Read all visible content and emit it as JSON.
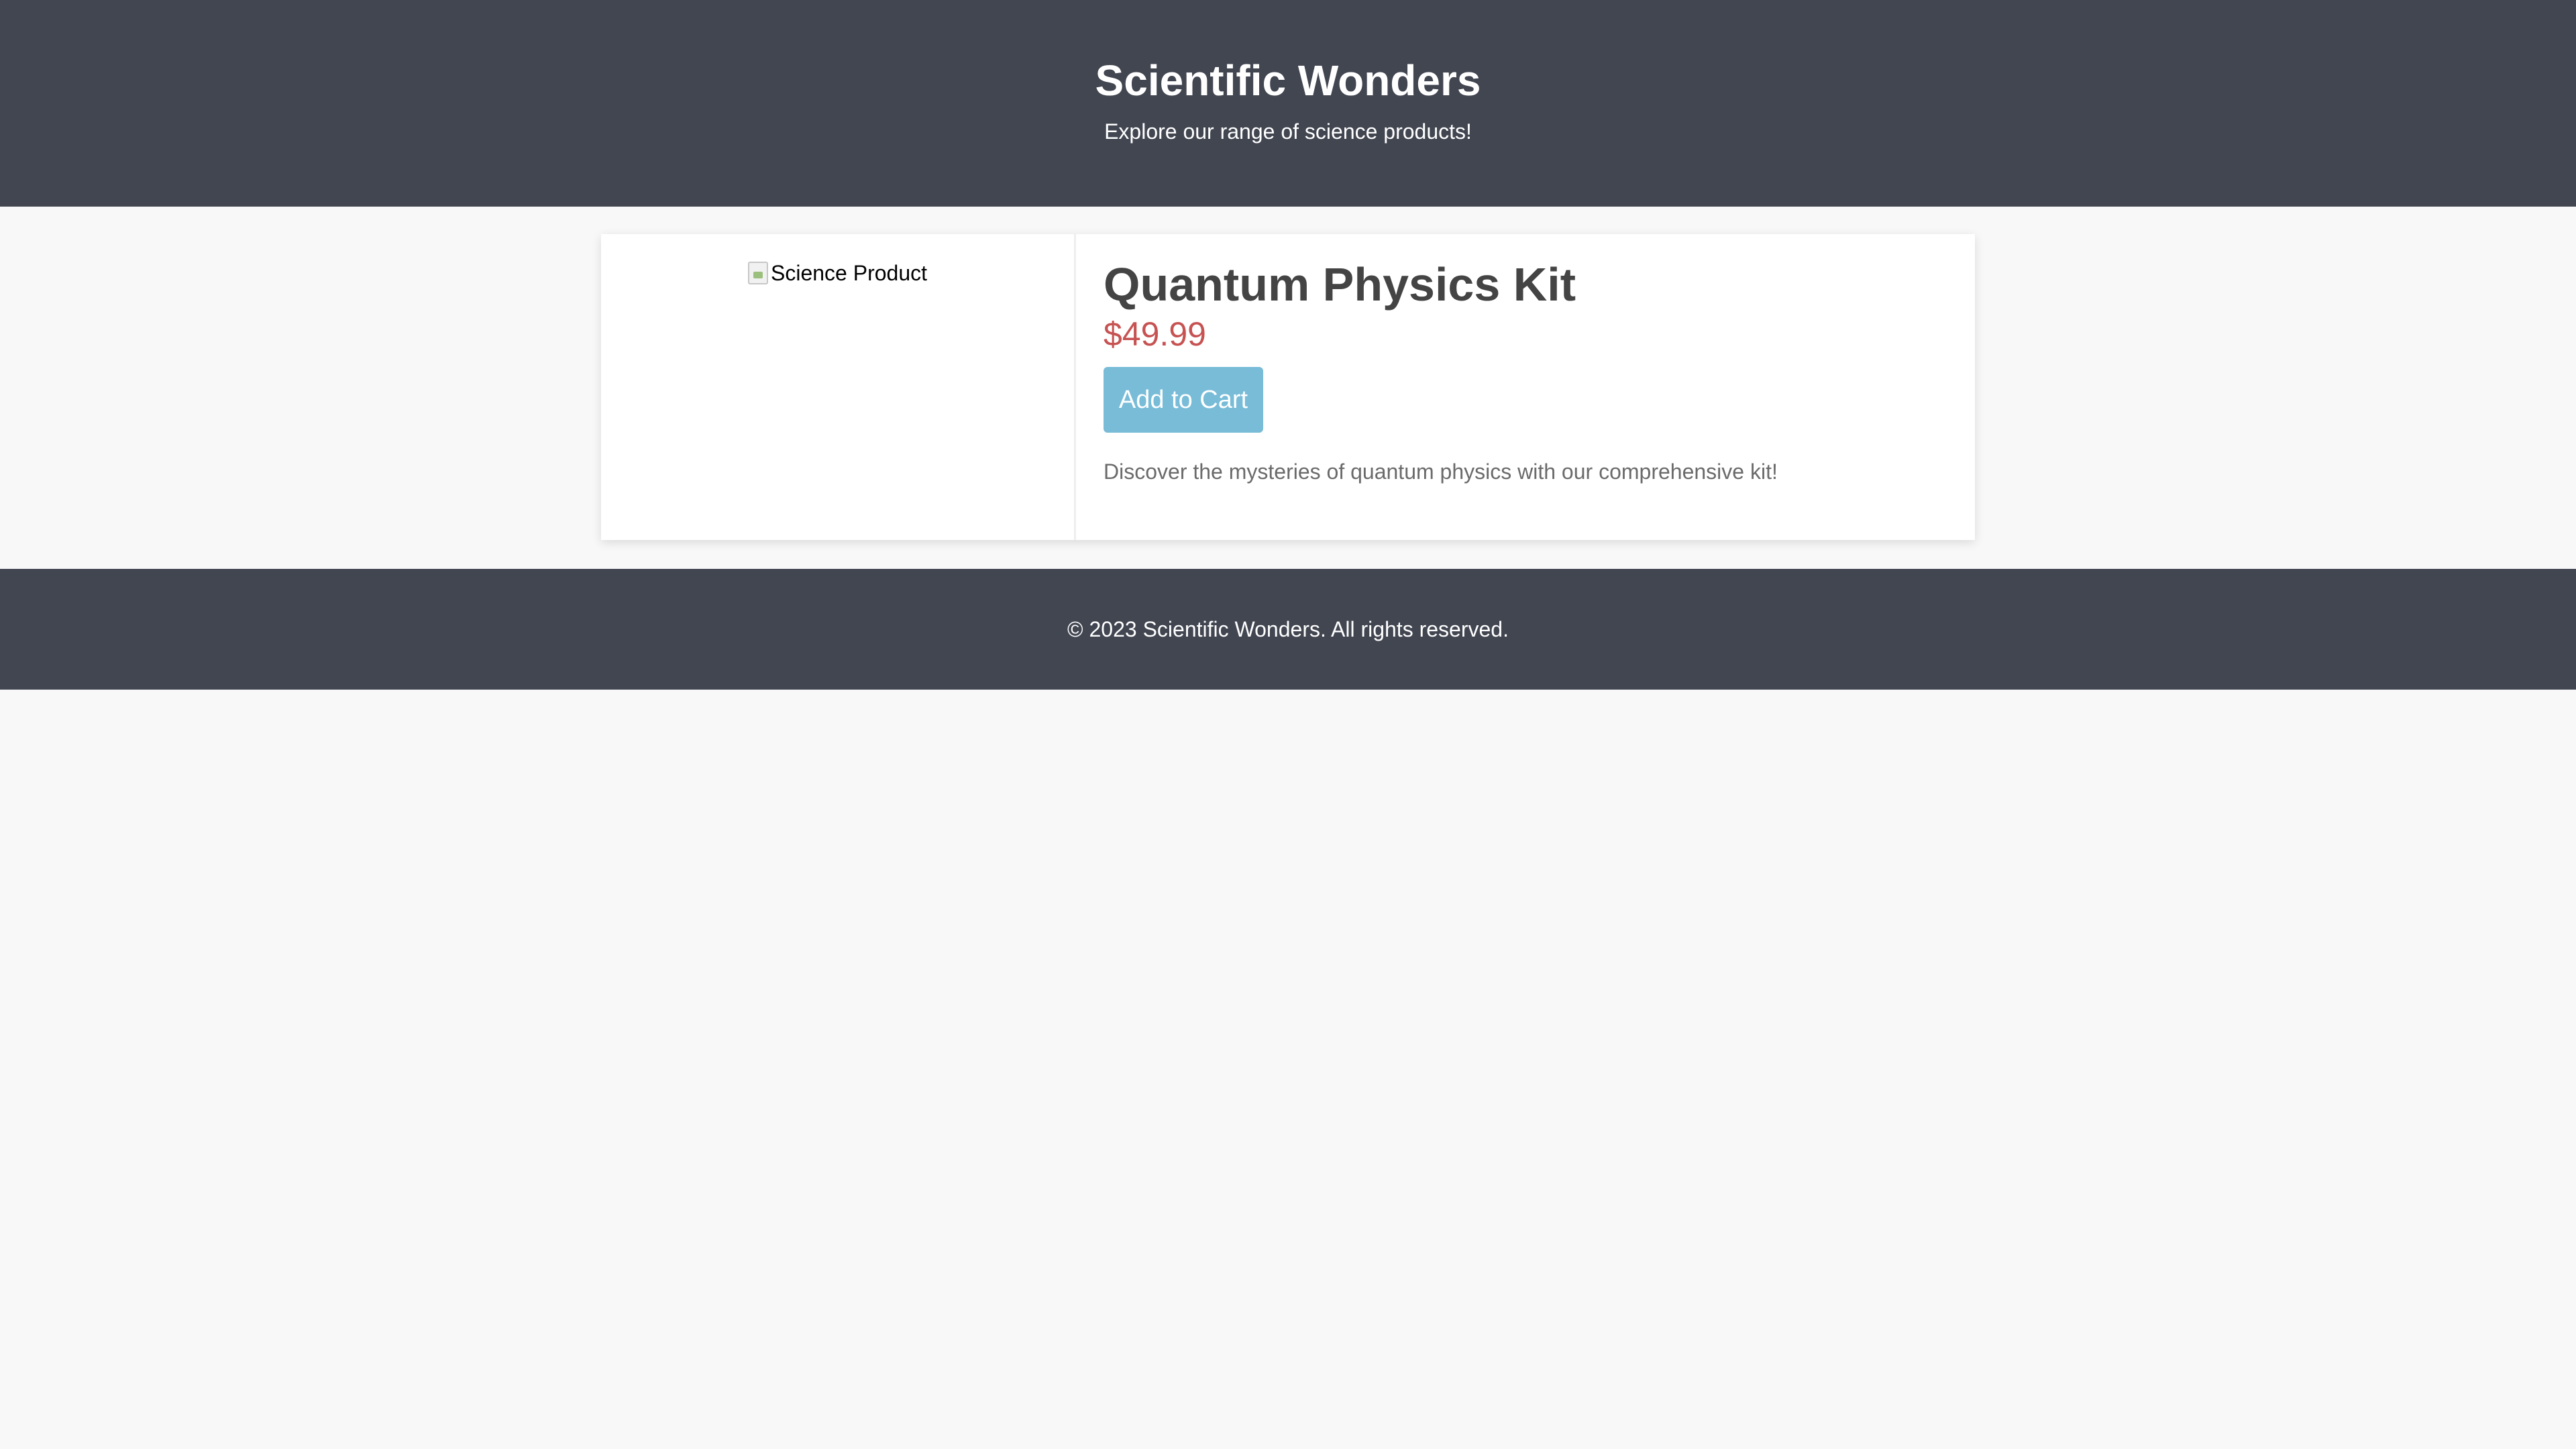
{
  "header": {
    "title": "Scientific Wonders",
    "tagline": "Explore our range of science products!"
  },
  "product": {
    "image_alt": "Science Product",
    "name": "Quantum Physics Kit",
    "price": "$49.99",
    "button_label": "Add to Cart",
    "description": "Discover the mysteries of quantum physics with our comprehensive kit!"
  },
  "footer": {
    "text": "© 2023 Scientific Wonders. All rights reserved."
  },
  "colors": {
    "header_bg": "#424651",
    "page_bg": "#f8f8f8",
    "price": "#c75252",
    "button_bg": "#78bcd8"
  },
  "icons": {
    "broken_image": "broken-image-icon"
  }
}
